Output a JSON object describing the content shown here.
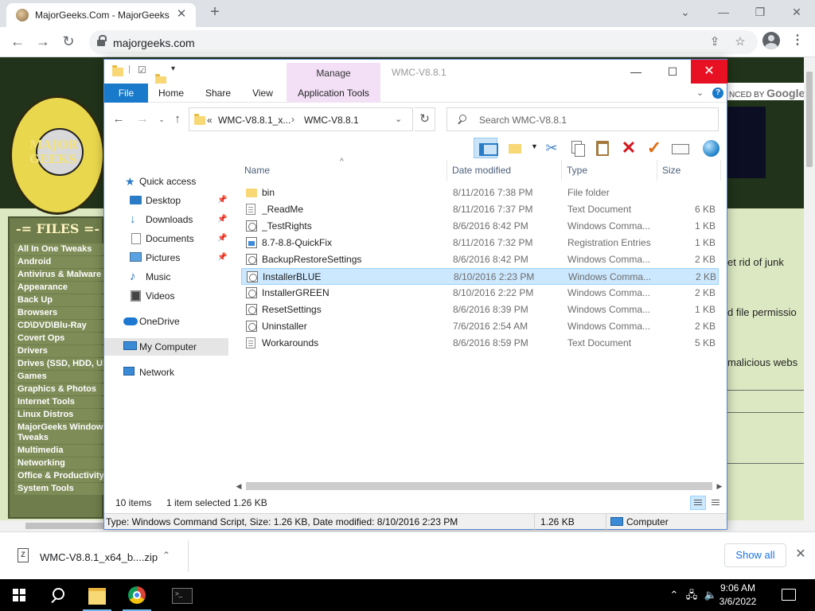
{
  "chrome": {
    "tab_title": "MajorGeeks.Com - MajorGeeks",
    "url": "majorgeeks.com"
  },
  "webpage": {
    "logo_text": "MAJOR GEEKS",
    "powered_by_prefix": "NCED BY",
    "powered_by_brand": "Google",
    "files_heading": "-= FILES =-",
    "categories": [
      "All In One Tweaks",
      "Android",
      "Antivirus & Malware",
      "Appearance",
      "Back Up",
      "Browsers",
      "CD\\DVD\\Blu-Ray",
      "Covert Ops",
      "Drivers",
      "Drives (SSD, HDD, USB)",
      "Games",
      "Graphics & Photos",
      "Internet Tools",
      "Linux Distros",
      "MajorGeeks Windows",
      "Tweaks",
      "Multimedia",
      "Networking",
      "Office & Productivity",
      "System Tools"
    ],
    "snippets": [
      "et rid of junk",
      "d file permissio",
      "malicious webs"
    ]
  },
  "explorer": {
    "title": "WMC-V8.8.1",
    "context_tab": "Manage",
    "ribbon_tabs": [
      "File",
      "Home",
      "Share",
      "View",
      "Application Tools"
    ],
    "breadcrumb": [
      "WMC-V8.8.1_x...",
      "WMC-V8.8.1"
    ],
    "search_placeholder": "Search WMC-V8.8.1",
    "nav": [
      {
        "label": "Quick access",
        "icon": "star-icon"
      },
      {
        "label": "Desktop",
        "icon": "desktop-icon"
      },
      {
        "label": "Downloads",
        "icon": "downloads-icon"
      },
      {
        "label": "Documents",
        "icon": "documents-icon"
      },
      {
        "label": "Pictures",
        "icon": "pictures-icon"
      },
      {
        "label": "Music",
        "icon": "music-icon"
      },
      {
        "label": "Videos",
        "icon": "videos-icon"
      },
      {
        "label": "OneDrive",
        "icon": "onedrive-icon"
      },
      {
        "label": "My Computer",
        "icon": "computer-icon"
      },
      {
        "label": "Network",
        "icon": "network-icon"
      }
    ],
    "columns": [
      "Name",
      "Date modified",
      "Type",
      "Size"
    ],
    "files": [
      {
        "name": "bin",
        "date": "8/11/2016 7:38 PM",
        "type": "File folder",
        "size": "",
        "icon": "folder-icon"
      },
      {
        "name": "_ReadMe",
        "date": "8/11/2016 7:37 PM",
        "type": "Text Document",
        "size": "6 KB",
        "icon": "text-file-icon"
      },
      {
        "name": "_TestRights",
        "date": "8/6/2016 8:42 PM",
        "type": "Windows Comma...",
        "size": "1 KB",
        "icon": "script-file-icon"
      },
      {
        "name": "8.7-8.8-QuickFix",
        "date": "8/11/2016 7:32 PM",
        "type": "Registration Entries",
        "size": "1 KB",
        "icon": "registry-file-icon"
      },
      {
        "name": "BackupRestoreSettings",
        "date": "8/6/2016 8:42 PM",
        "type": "Windows Comma...",
        "size": "2 KB",
        "icon": "script-file-icon"
      },
      {
        "name": "InstallerBLUE",
        "date": "8/10/2016 2:23 PM",
        "type": "Windows Comma...",
        "size": "2 KB",
        "icon": "script-file-icon",
        "selected": true
      },
      {
        "name": "InstallerGREEN",
        "date": "8/10/2016 2:22 PM",
        "type": "Windows Comma...",
        "size": "2 KB",
        "icon": "script-file-icon"
      },
      {
        "name": "ResetSettings",
        "date": "8/6/2016 8:39 PM",
        "type": "Windows Comma...",
        "size": "1 KB",
        "icon": "script-file-icon"
      },
      {
        "name": "Uninstaller",
        "date": "7/6/2016 2:54 AM",
        "type": "Windows Comma...",
        "size": "2 KB",
        "icon": "script-file-icon"
      },
      {
        "name": "Workarounds",
        "date": "8/6/2016 8:59 PM",
        "type": "Text Document",
        "size": "5 KB",
        "icon": "text-file-icon"
      }
    ],
    "status": {
      "item_count": "10 items",
      "selection": "1 item selected",
      "selection_size": "1.26 KB"
    },
    "infobar": {
      "details": "Type: Windows Command Script, Size: 1.26 KB, Date modified: 8/10/2016 2:23 PM",
      "size": "1.26 KB",
      "location": "Computer"
    }
  },
  "downloads": {
    "file": "WMC-V8.8.1_x64_b....zip",
    "show_all": "Show all"
  },
  "taskbar": {
    "time": "9:06 AM",
    "date": "3/6/2022"
  }
}
